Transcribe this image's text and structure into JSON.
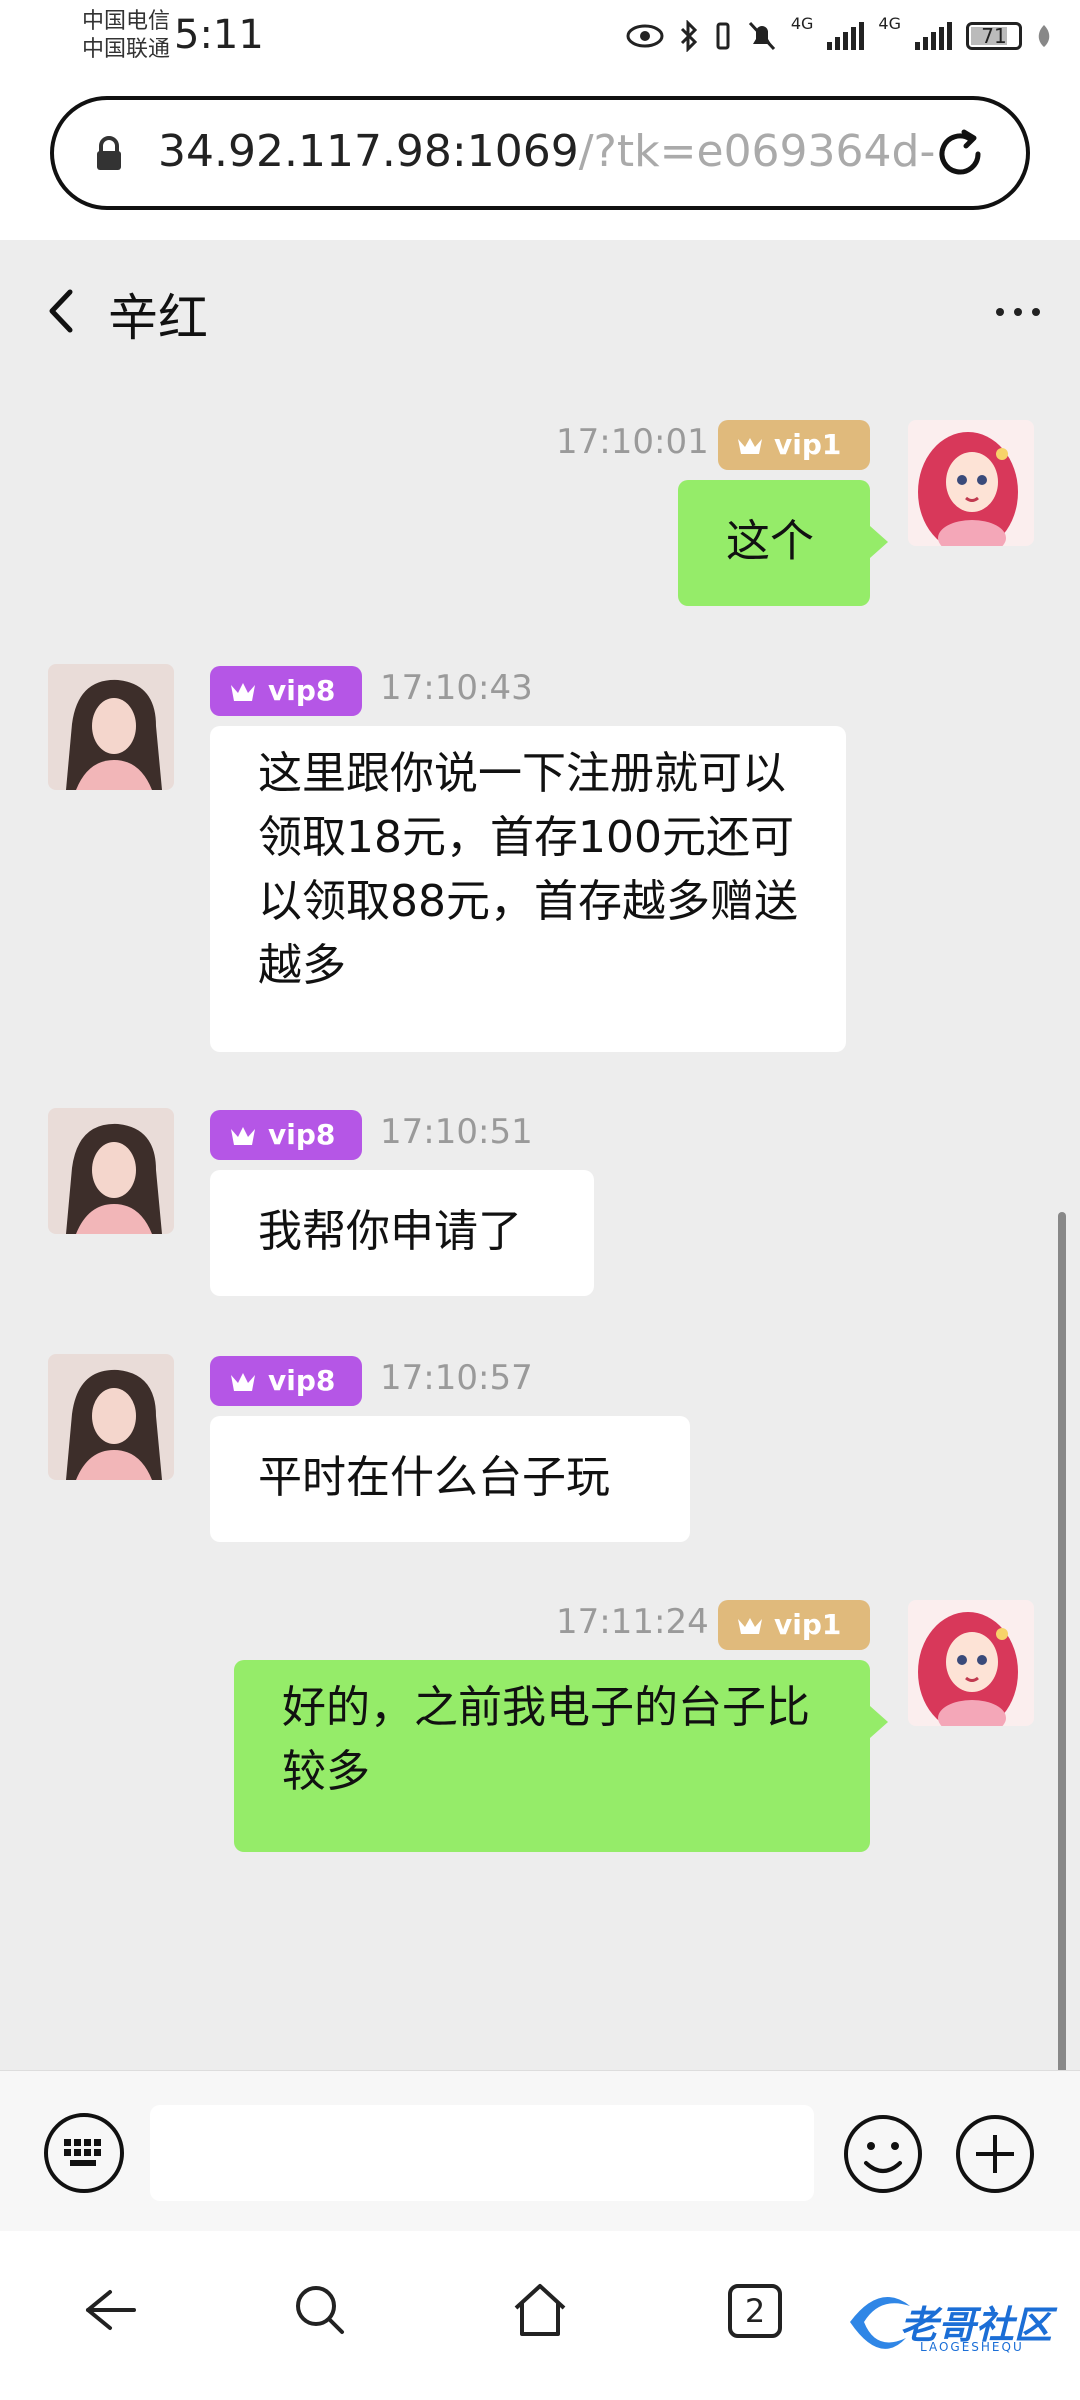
{
  "status_bar": {
    "carrier_1": "中国电信",
    "carrier_2": "中国联通",
    "time": "5:11",
    "network_1": "4G",
    "network_2": "4G",
    "battery": "71"
  },
  "browser": {
    "url_host": "34.92.117.98:1069",
    "url_rest": "/?tk=e069364d-"
  },
  "chat": {
    "contact_name": "辛红",
    "messages": [
      {
        "side": "out",
        "time": "17:10:01",
        "vip": "vip1",
        "text": "这个"
      },
      {
        "side": "in",
        "time": "17:10:43",
        "vip": "vip8",
        "text": "这里跟你说一下注册就可以领取18元，首存100元还可以领取88元，首存越多赠送越多"
      },
      {
        "side": "in",
        "time": "17:10:51",
        "vip": "vip8",
        "text": "我帮你申请了"
      },
      {
        "side": "in",
        "time": "17:10:57",
        "vip": "vip8",
        "text": "平时在什么台子玩"
      },
      {
        "side": "out",
        "time": "17:11:24",
        "vip": "vip1",
        "text": "好的，之前我电子的台子比较多"
      }
    ]
  },
  "input": {
    "placeholder": "",
    "value": ""
  },
  "nav": {
    "tab_count": "2"
  },
  "watermark": {
    "text": "老哥社区",
    "sub": "LAOGESHEQU"
  },
  "colors": {
    "chat_background": "#ededed",
    "outgoing_bubble": "#95ec69",
    "incoming_bubble": "#ffffff",
    "vip_low_badge": "#e0ba7c",
    "vip_high_badge": "#b556e6"
  }
}
